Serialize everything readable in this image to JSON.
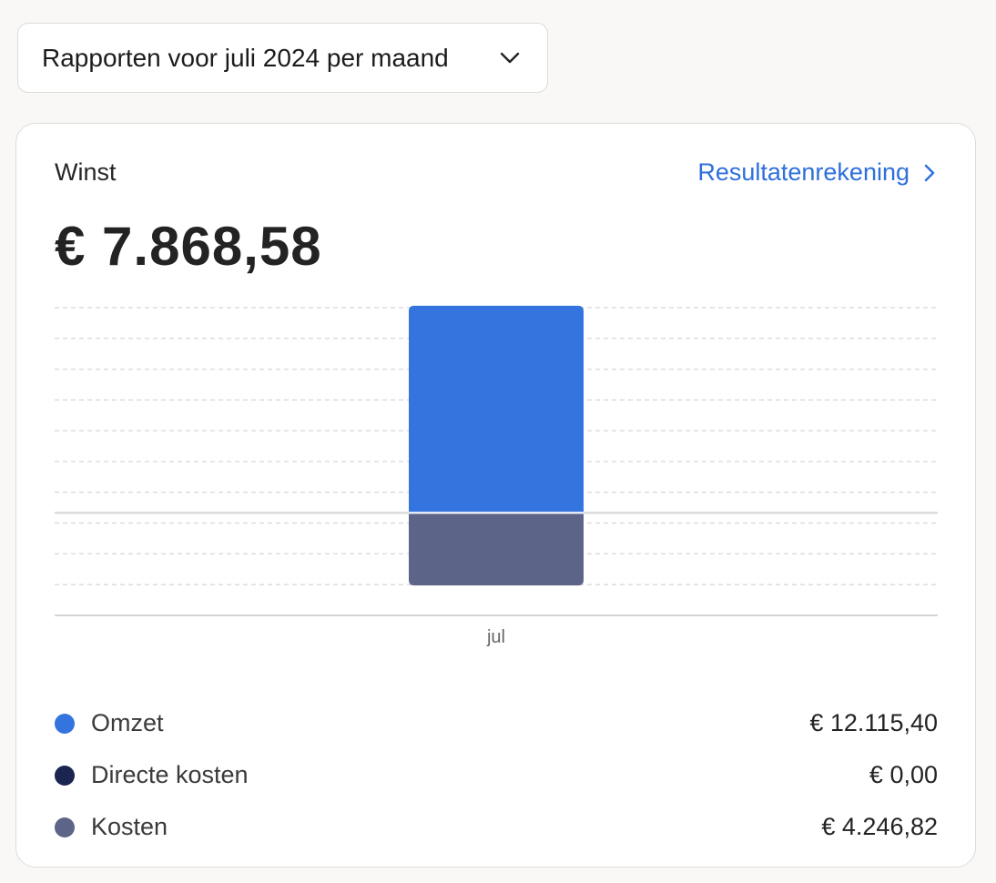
{
  "period_selector": {
    "label": "Rapporten voor juli 2024 per maand",
    "icon": "chevron-down-icon"
  },
  "card": {
    "title": "Winst",
    "link_label": "Resultatenrekening",
    "link_icon": "chevron-right-icon",
    "profit_value": "€ 7.868,58"
  },
  "colors": {
    "omzet": "#3374de",
    "directe_kosten": "#1c2550",
    "kosten": "#5c6587",
    "link": "#2e6fdb",
    "grid": "#dddddd",
    "axis": "#d4d4d4"
  },
  "chart_data": {
    "type": "bar",
    "categories": [
      "jul"
    ],
    "series": [
      {
        "name": "Omzet",
        "values": [
          12115.4
        ]
      },
      {
        "name": "Directe kosten",
        "values": [
          0.0
        ]
      },
      {
        "name": "Kosten",
        "values": [
          -4246.82
        ]
      }
    ],
    "ylim": [
      -6000,
      12000
    ],
    "grid": true,
    "legend": "bottom"
  },
  "legend": [
    {
      "key": "omzet",
      "name": "Omzet",
      "value": "€ 12.115,40"
    },
    {
      "key": "directe_kosten",
      "name": "Directe kosten",
      "value": "€ 0,00"
    },
    {
      "key": "kosten",
      "name": "Kosten",
      "value": "€ 4.246,82"
    }
  ]
}
